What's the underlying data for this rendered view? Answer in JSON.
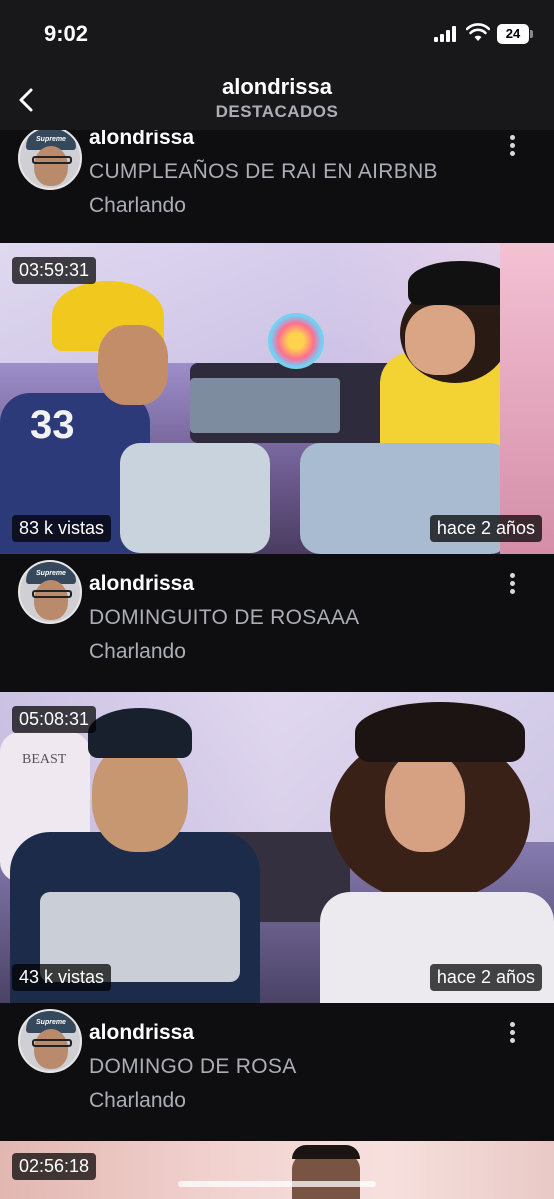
{
  "status_bar": {
    "time": "9:02",
    "battery": "24"
  },
  "header": {
    "title": "alondrissa",
    "subtitle": "DESTACADOS"
  },
  "items": [
    {
      "channel": "alondrissa",
      "title": "CUMPLEAÑOS DE RAI EN AIRBNB",
      "category": "Charlando",
      "duration": "03:59:31",
      "views": "83 k vistas",
      "age": "hace 2 años"
    },
    {
      "channel": "alondrissa",
      "title": "DOMINGUITO DE ROSAAA",
      "category": "Charlando",
      "duration": "05:08:31",
      "views": "43 k vistas",
      "age": "hace 2 años"
    },
    {
      "channel": "alondrissa",
      "title": "DOMINGO DE ROSA",
      "category": "Charlando",
      "duration": "02:56:18"
    }
  ],
  "icons": {
    "back": "chevron-left-icon",
    "more": "vertical-dots-icon",
    "signal": "cellular-signal-icon",
    "wifi": "wifi-icon",
    "battery": "battery-icon"
  },
  "colors": {
    "background": "#0e0e10",
    "header": "#18181b",
    "text": "#efeff1",
    "secondary": "#adadb8"
  }
}
